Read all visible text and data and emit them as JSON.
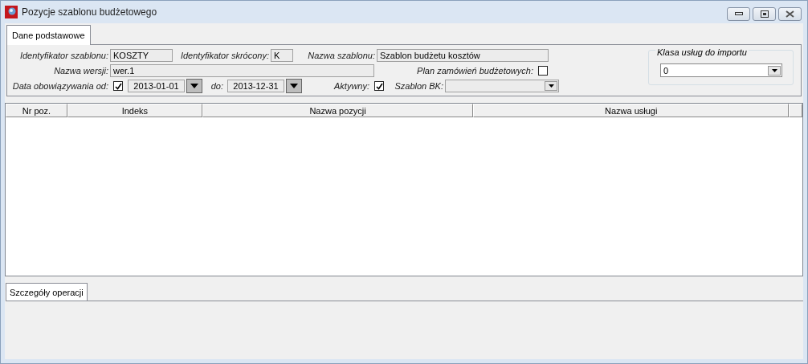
{
  "window": {
    "title": "Pozycje szablonu budżetowego"
  },
  "tabs": [
    {
      "label": "Dane podstawowe",
      "selected": true
    }
  ],
  "form": {
    "template_id": {
      "label": "Identyfikator szablonu:",
      "value": "KOSZTY"
    },
    "short_id": {
      "label": "Identyfikator skrócony:",
      "value": "K"
    },
    "template_name": {
      "label": "Nazwa szablonu:",
      "value": "Szablon budżetu kosztów"
    },
    "version_name": {
      "label": "Nazwa wersji:",
      "value": "wer.1"
    },
    "budget_plan": {
      "label": "Plan zamówień budżetowych:",
      "checked": false
    },
    "valid_from": {
      "label": "Data obowiązywania od:",
      "checked": true,
      "value": "2013-01-01"
    },
    "valid_to": {
      "label": "do:",
      "value": "2013-12-31"
    },
    "active": {
      "label": "Aktywny:",
      "checked": true
    },
    "bk_template": {
      "label": "Szablon BK:"
    }
  },
  "import_class": {
    "title": "Klasa usług do importu",
    "value": "0"
  },
  "table": {
    "columns": [
      "Nr poz.",
      "Indeks",
      "Nazwa pozycji",
      "Nazwa usługi"
    ]
  },
  "bottom_tabs": [
    {
      "label": "Szczegóły operacji",
      "selected": true
    }
  ]
}
